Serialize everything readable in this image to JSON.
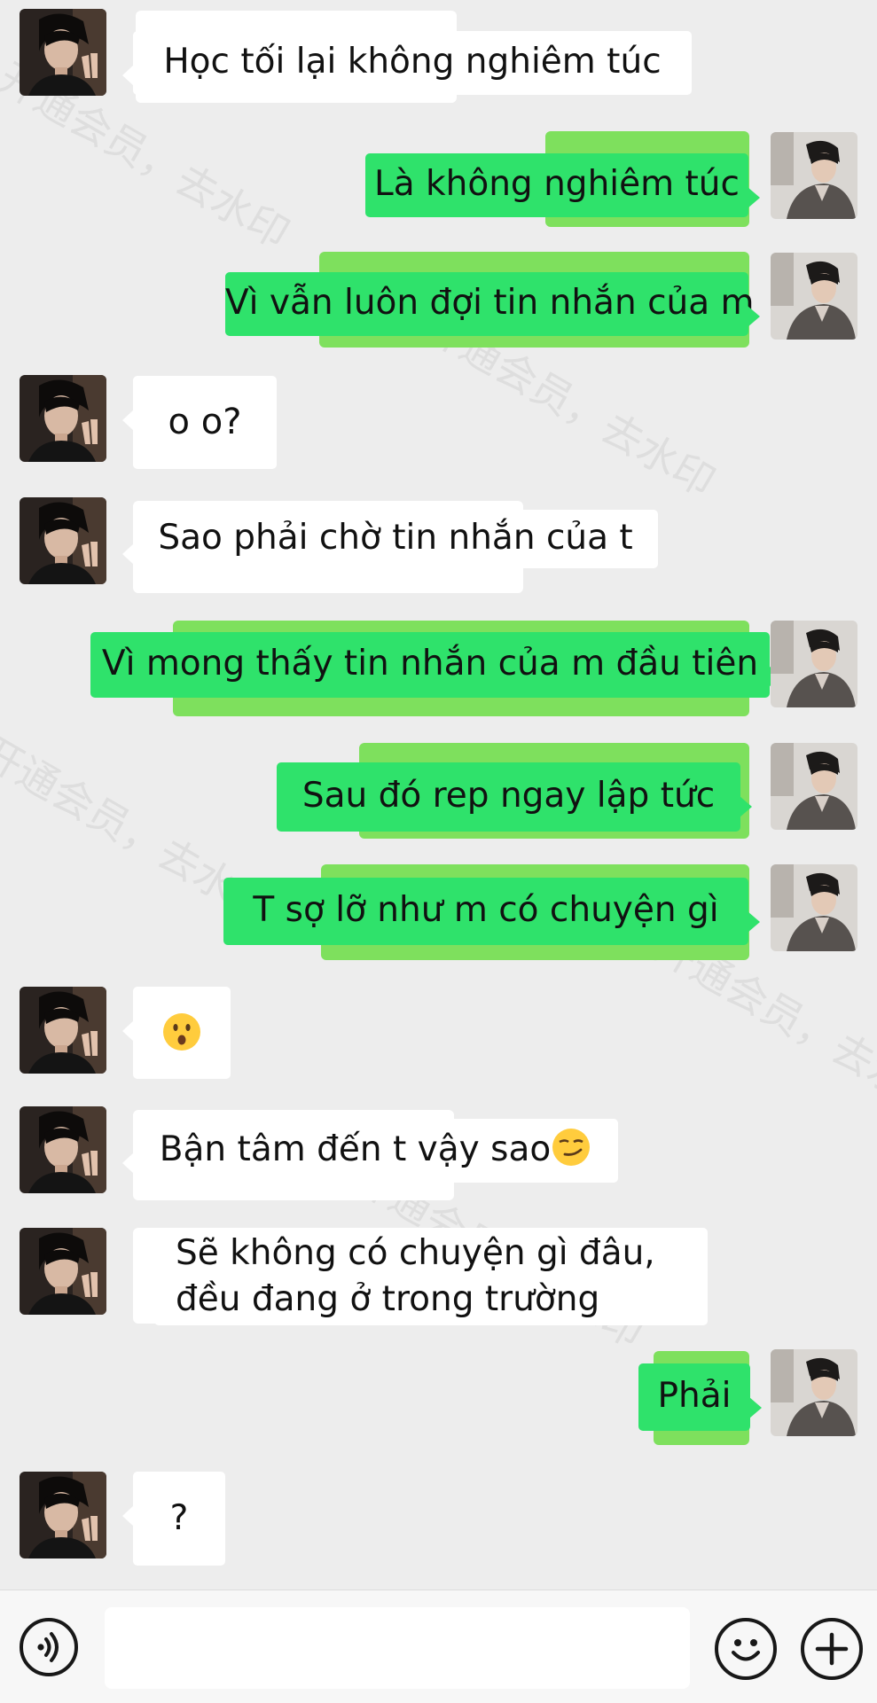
{
  "messages": [
    {
      "side": "in",
      "text": "Học tối lại không nghiêm túc"
    },
    {
      "side": "out",
      "text": "Là không nghiêm túc"
    },
    {
      "side": "out",
      "text": "Vì vẫn luôn đợi tin nhắn của m"
    },
    {
      "side": "in",
      "text": "o o?"
    },
    {
      "side": "in",
      "text": "Sao phải chờ tin nhắn của t"
    },
    {
      "side": "out",
      "text": "Vì mong thấy tin nhắn của m đầu tiên"
    },
    {
      "side": "out",
      "text": "Sau đó rep ngay lập tức"
    },
    {
      "side": "out",
      "text": "T sợ lỡ như m có chuyện gì"
    },
    {
      "side": "in",
      "text": "",
      "emoji": "hushed-face-emoji"
    },
    {
      "side": "in",
      "text": "Bận tâm đến t vậy sao",
      "emoji": "smirking-face-emoji"
    },
    {
      "side": "in",
      "lines": [
        "Sẽ không có chuyện gì đâu,",
        "đều đang ở trong trường"
      ]
    },
    {
      "side": "out",
      "text": "Phải"
    },
    {
      "side": "in",
      "text": "?"
    }
  ],
  "watermark": "开通会员，去水印",
  "input_bar": {
    "value": "",
    "icons": [
      "voice-icon",
      "emoji-icon",
      "plus-icon"
    ]
  },
  "colors": {
    "background": "#ededed",
    "outgoing_bubble": "#2fe26b",
    "incoming_bubble": "#ffffff"
  }
}
